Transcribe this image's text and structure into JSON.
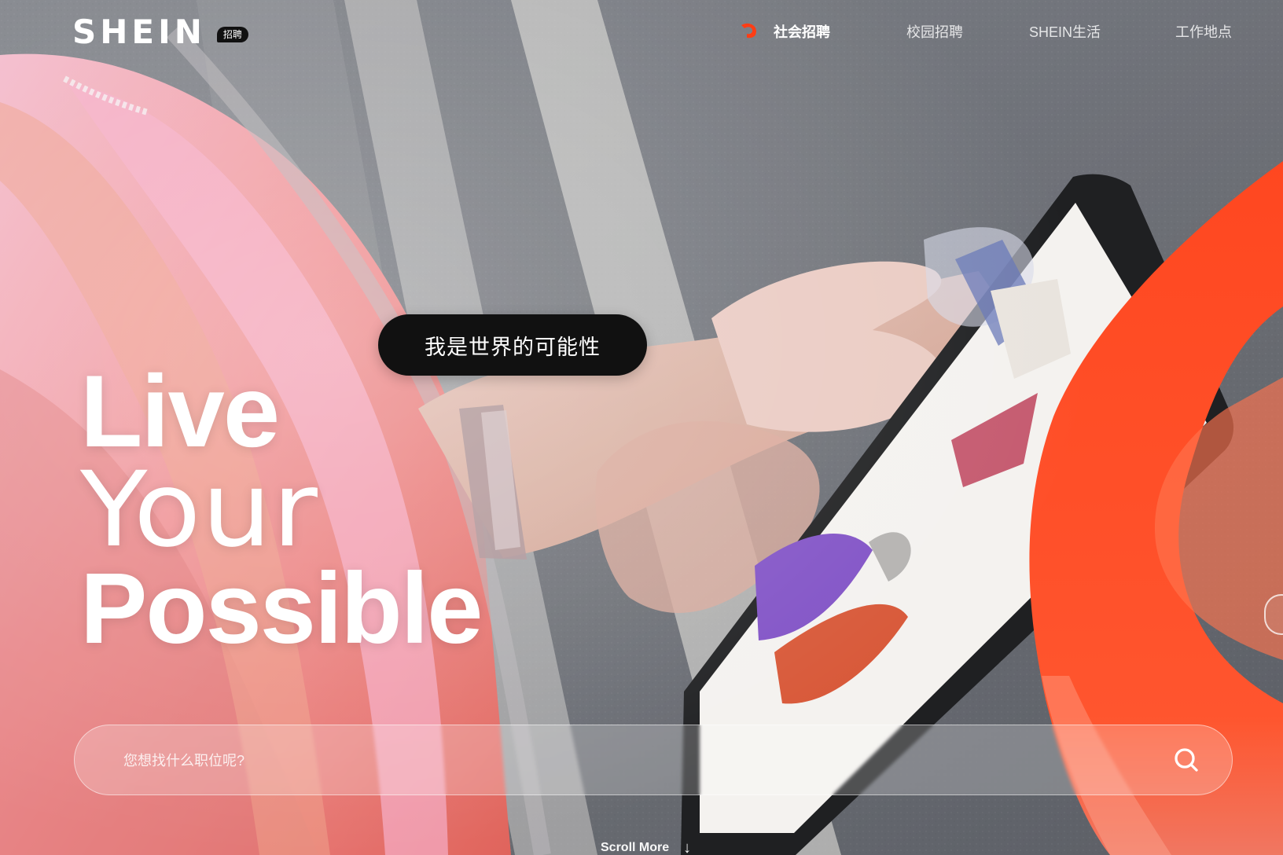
{
  "brand": {
    "logo_text": "SHEIN",
    "badge_text": "招聘"
  },
  "nav": {
    "items": [
      {
        "label": "社会招聘",
        "active": true
      },
      {
        "label": "校园招聘",
        "active": false
      },
      {
        "label": "SHEIN生活",
        "active": false
      },
      {
        "label": "工作地点",
        "active": false
      }
    ]
  },
  "hero": {
    "bubble_text": "我是世界的可能性",
    "headline": [
      "Live",
      "Your",
      "Possible"
    ]
  },
  "search": {
    "placeholder": "您想找什么职位呢?"
  },
  "footer": {
    "scroll_text": "Scroll More"
  },
  "icons": {
    "search": "search-icon",
    "scroll": "arrow-down-icon",
    "active_nav": "active-indicator-icon"
  },
  "colors": {
    "accent": "#ff3d14",
    "text": "#ffffff",
    "bubble": "#111111"
  }
}
